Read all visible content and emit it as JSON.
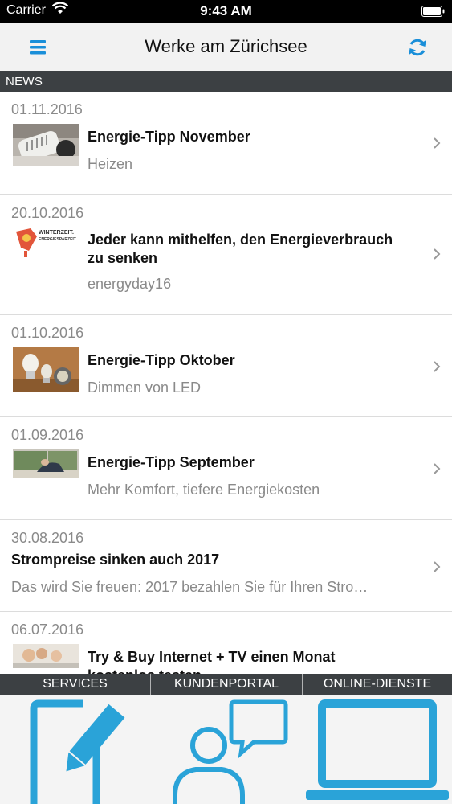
{
  "status_bar": {
    "carrier": "Carrier",
    "time": "9:43 AM"
  },
  "header": {
    "title": "Werke am Zürichsee",
    "menu_icon": "hamburger-icon",
    "refresh_icon": "refresh-icon"
  },
  "section": {
    "title": "NEWS"
  },
  "news": [
    {
      "date": "01.11.2016",
      "title": "Energie-Tipp November",
      "subtitle": "Heizen",
      "thumbnail": "thermostat"
    },
    {
      "date": "20.10.2016",
      "title_line1": "Jeder kann mithelfen, den Energieverbrauch",
      "title_line2": "zu senken",
      "subtitle": "energyday16",
      "thumbnail": "energyday-poster",
      "thumb_text1": "WINTERZEIT.",
      "thumb_text2": "ENERGIESPARZEIT."
    },
    {
      "date": "01.10.2016",
      "title": "Energie-Tipp Oktober",
      "subtitle": "Dimmen von LED",
      "thumbnail": "led-bulbs"
    },
    {
      "date": "01.09.2016",
      "title": "Energie-Tipp September",
      "subtitle": "Mehr Komfort, tiefere Energiekosten",
      "thumbnail": "window-radiator"
    },
    {
      "date": "30.08.2016",
      "title": "Strompreise sinken auch 2017",
      "subtitle": "Das wird Sie freuen: 2017 bezahlen Sie für Ihren Stro…"
    },
    {
      "date": "06.07.2016",
      "title_line1": "Try & Buy  Internet + TV einen Monat",
      "title_line2": "kostenlos testen",
      "thumbnail": "family-tv"
    }
  ],
  "tabs": [
    {
      "label": "SERVICES",
      "icon": "edit-document-icon"
    },
    {
      "label": "KUNDENPORTAL",
      "icon": "user-chat-icon"
    },
    {
      "label": "ONLINE-DIENSTE",
      "icon": "laptop-icon"
    }
  ],
  "colors": {
    "accent": "#1a8fd9",
    "header_bar": "#3c4043",
    "icon_blue": "#2aa3d8"
  }
}
